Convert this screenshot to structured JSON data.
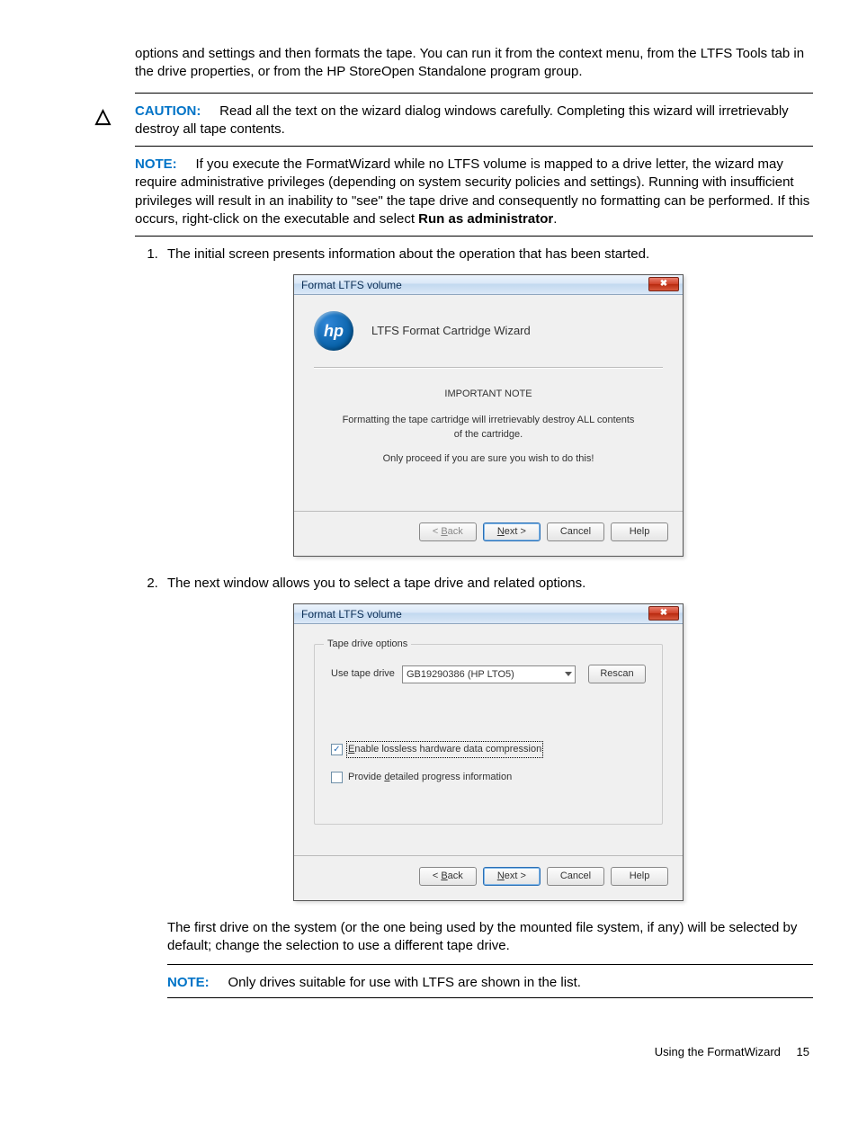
{
  "intro_para": "options and settings and then formats the tape. You can run it from the context menu, from the LTFS Tools tab in the drive properties, or from the HP StoreOpen Standalone program group.",
  "caution": {
    "label": "CAUTION:",
    "text": "Read all the text on the wizard dialog windows carefully. Completing this wizard will irretrievably destroy all tape contents."
  },
  "note1": {
    "label": "NOTE:",
    "text_pre": "If you execute the FormatWizard while no LTFS volume is mapped to a drive letter, the wizard may require administrative privileges (depending on system security policies and settings). Running with insufficient privileges will result in an inability to \"see\" the tape drive and consequently no formatting can be performed. If this occurs, right-click on the executable and select ",
    "bold": "Run as administrator",
    "text_post": "."
  },
  "step1_text": "The initial screen presents information about the operation that has been started.",
  "step2_text": "The next window allows you to select a tape drive and related options.",
  "after_step2_para": "The first drive on the system (or the one being used by the mounted file system, if any) will be selected by default; change the selection to use a different tape drive.",
  "note2": {
    "label": "NOTE:",
    "text": "Only drives suitable for use with LTFS are shown in the list."
  },
  "wizard1": {
    "title": "Format LTFS volume",
    "hp": "hp",
    "subtitle": "LTFS Format Cartridge Wizard",
    "heading": "IMPORTANT NOTE",
    "line1": "Formatting the tape cartridge will irretrievably destroy ALL contents of the cartridge.",
    "line2": "Only proceed if you are sure you wish to do this!",
    "btn_back_pre": "< ",
    "btn_back_u": "B",
    "btn_back_post": "ack",
    "btn_next_u": "N",
    "btn_next_post": "ext >",
    "btn_cancel": "Cancel",
    "btn_help": "Help"
  },
  "wizard2": {
    "title": "Format LTFS volume",
    "group_legend": "Tape drive options",
    "use_drive_label": "Use tape drive",
    "drive_value": "GB19290386 (HP LTO5)",
    "rescan": "Rescan",
    "chk1_u": "E",
    "chk1_rest": "nable lossless hardware data compression",
    "chk2_pre": "Provide ",
    "chk2_u": "d",
    "chk2_post": "etailed progress information",
    "btn_back_pre": "< ",
    "btn_back_u": "B",
    "btn_back_post": "ack",
    "btn_next_u": "N",
    "btn_next_post": "ext >",
    "btn_cancel": "Cancel",
    "btn_help": "Help"
  },
  "footer": {
    "section": "Using the FormatWizard",
    "page": "15"
  }
}
